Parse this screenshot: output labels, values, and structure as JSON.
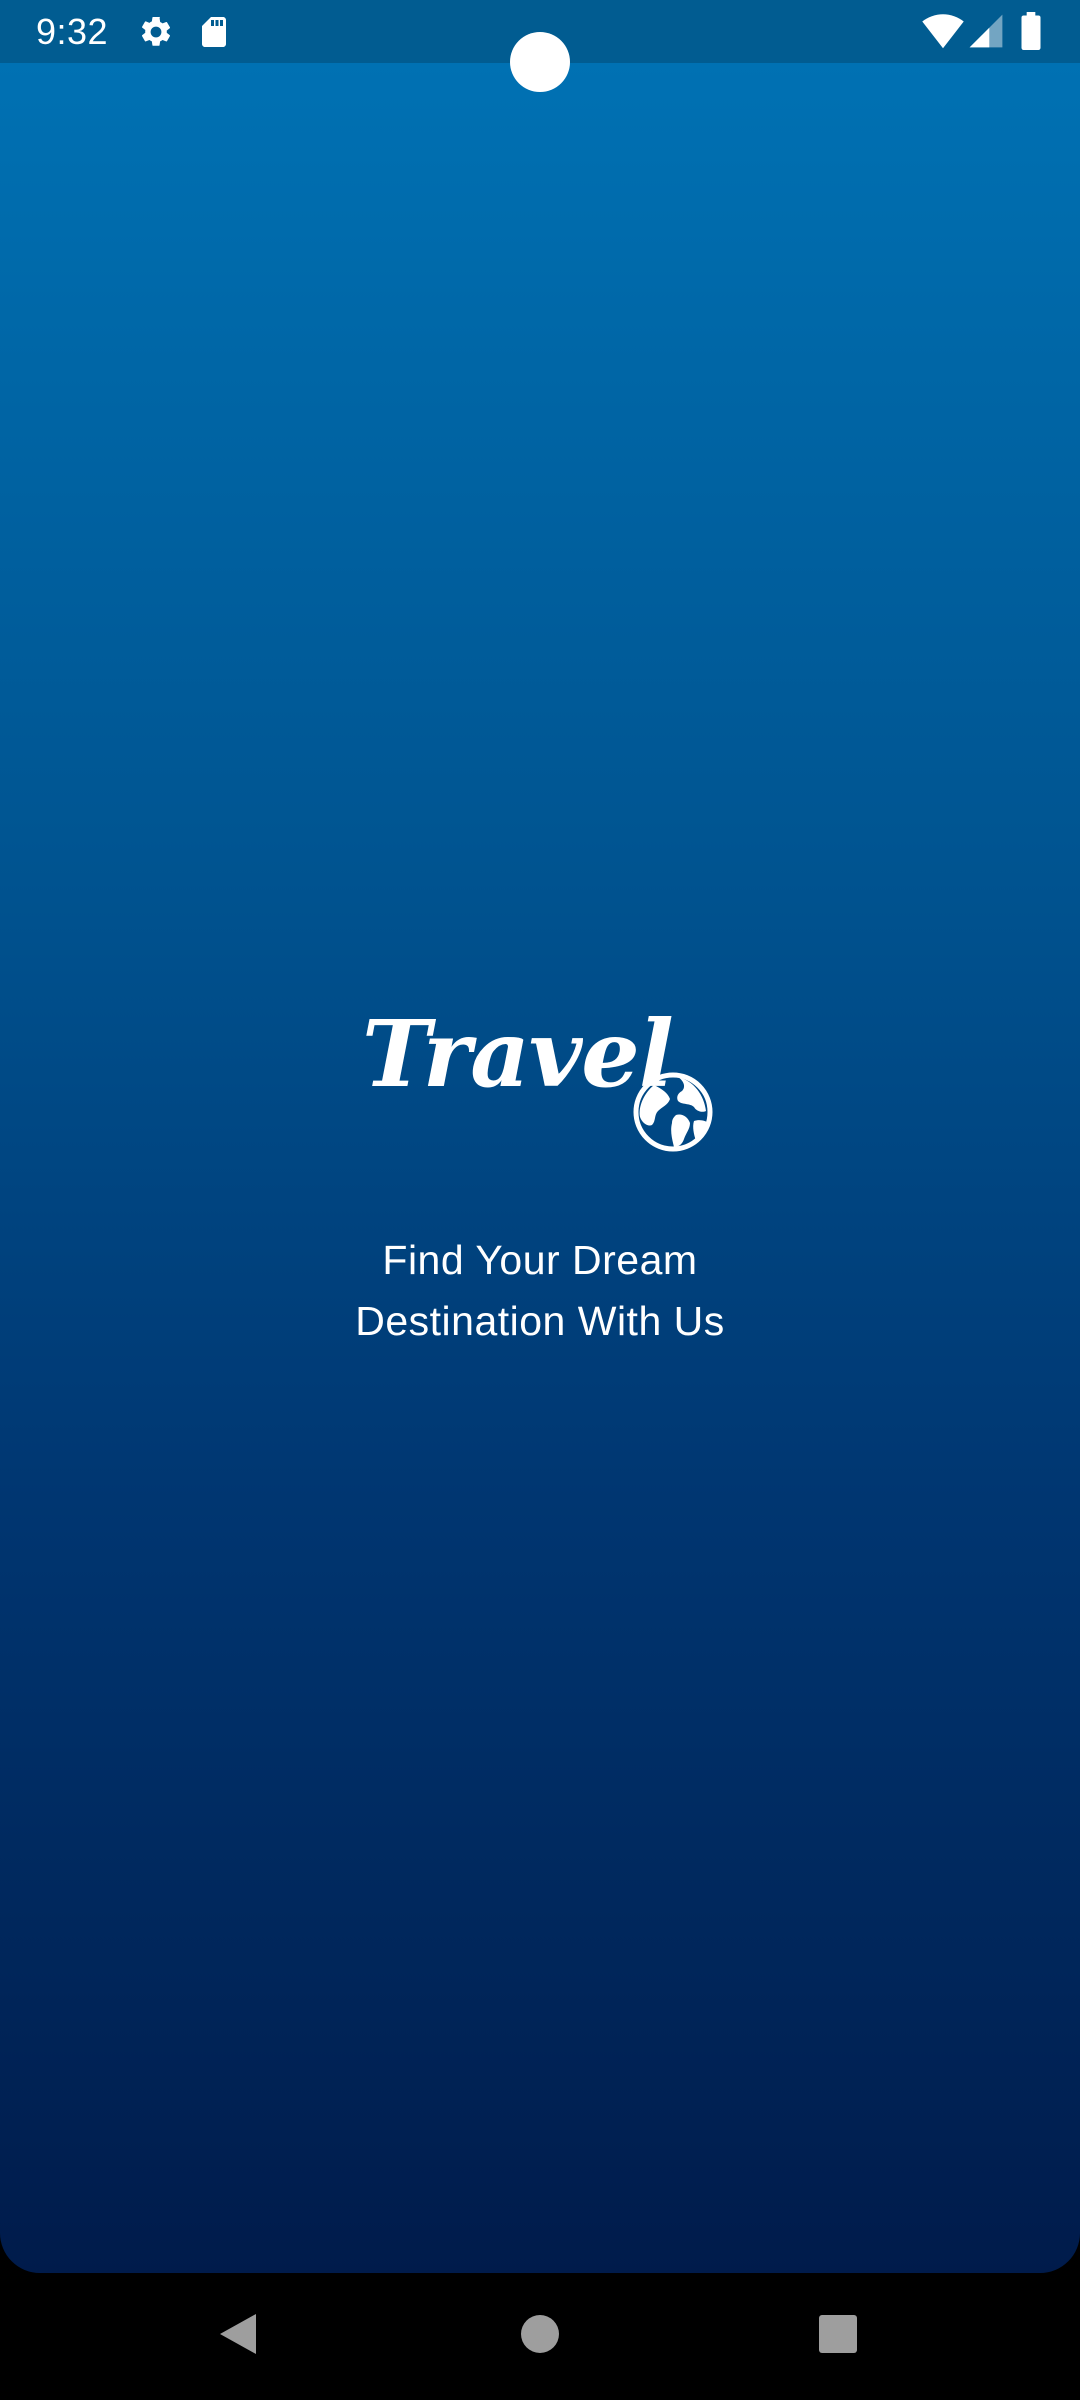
{
  "status_bar": {
    "time": "9:32",
    "left_icons": [
      "gear-icon",
      "sd-card-icon"
    ],
    "right_icons": [
      "wifi-icon",
      "cellular-signal-icon",
      "battery-icon"
    ],
    "background_color": "#015c91"
  },
  "splash": {
    "logo_text": "Travel",
    "logo_icon": "globe-icon",
    "tagline_line_1": "Find Your Dream",
    "tagline_line_2": "Destination With Us",
    "gradient_top": "#0071b3",
    "gradient_bottom": "#001b4b",
    "text_color": "#ffffff"
  },
  "nav_bar": {
    "buttons": [
      "back-icon",
      "home-icon",
      "recents-icon"
    ],
    "icon_color": "#9e9e9e"
  }
}
